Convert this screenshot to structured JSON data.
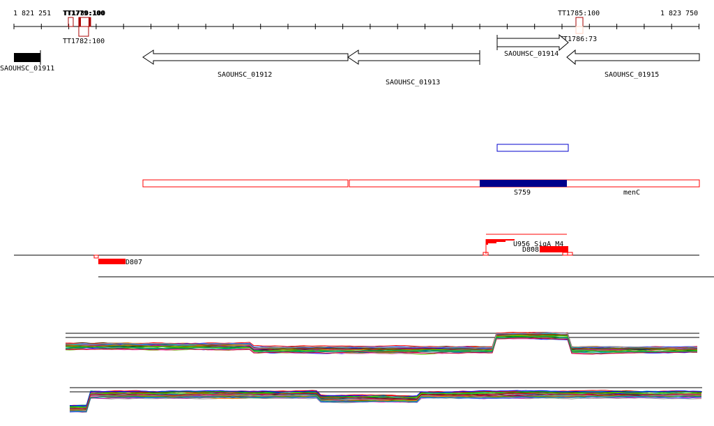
{
  "ruler": {
    "start": "1 821 251",
    "end": "1 823 750"
  },
  "terminators": [
    {
      "label": "TT1779:100"
    },
    {
      "label": "TT1780:100"
    },
    {
      "label": "TT1782:100"
    },
    {
      "label": "TT1785:100"
    },
    {
      "label": "TT1786:73"
    }
  ],
  "genes": [
    {
      "label": "SAOUHSC_01911"
    },
    {
      "label": "SAOUHSC_01912"
    },
    {
      "label": "SAOUHSC_01913"
    },
    {
      "label": "SAOUHSC_01914"
    },
    {
      "label": "SAOUHSC_01915"
    }
  ],
  "operon": {
    "s_label": "S759",
    "gene_label": "menC"
  },
  "features": {
    "u_label": "U956_SigA_M4",
    "d808": "D808",
    "d807": "D807"
  },
  "colors": {
    "red": "#ff0000",
    "darkred": "#aa0000",
    "navy": "#00008b",
    "blue": "#0000cc"
  },
  "expression_palette": [
    "#000000",
    "#ff0000",
    "#00aa00",
    "#0000ff",
    "#ff8800",
    "#aa00aa",
    "#00aaaa",
    "#888800",
    "#ff66cc",
    "#663300",
    "#66cc00",
    "#3366ff",
    "#999999",
    "#cc0033",
    "#009966"
  ]
}
